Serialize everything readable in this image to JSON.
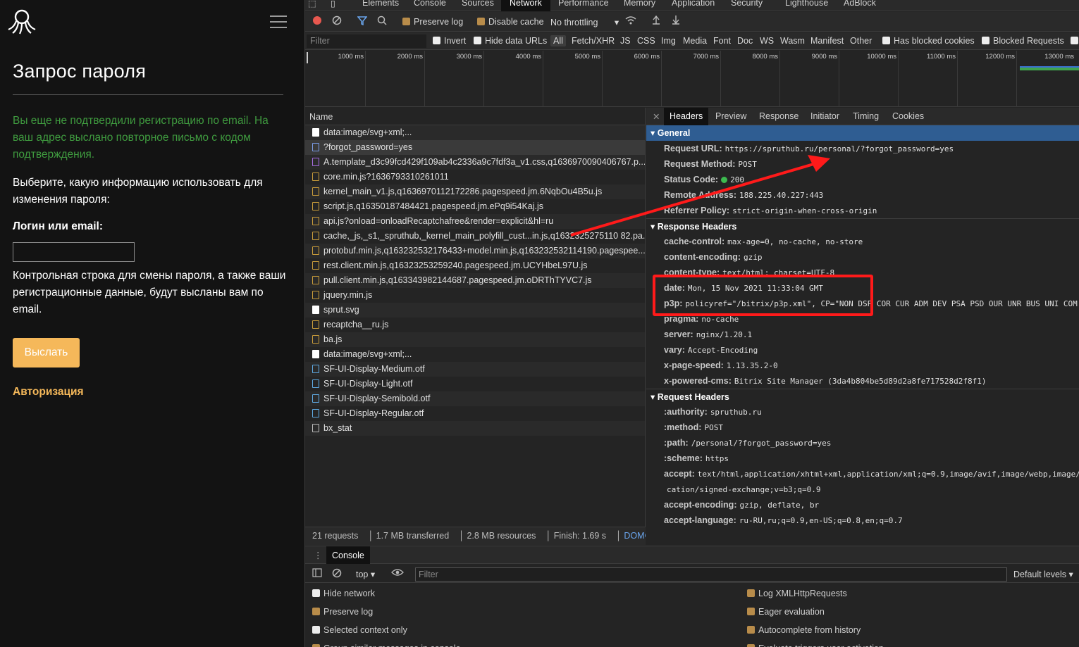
{
  "site": {
    "title": "Запрос пароля",
    "notice": "Вы еще не подтвердили регистрацию по email. На ваш адрес выслано повторное письмо с кодом подтверждения.",
    "choose": "Выберите, какую информацию использовать для изменения пароля:",
    "login_label": "Логин или email:",
    "login_value": "",
    "control_text": "Контрольная строка для смены пароля, а также ваши регистрационные данные, будут высланы вам по email.",
    "send_button": "Выслать",
    "auth_link": "Авторизация",
    "colors": {
      "notice": "#3f9b3f",
      "accent": "#f5b85a",
      "background": "#131313"
    }
  },
  "devtools": {
    "tabs": [
      "Elements",
      "Console",
      "Sources",
      "Network",
      "Performance",
      "Memory",
      "Application",
      "Security",
      "Lighthouse",
      "AdBlock"
    ],
    "active_tab": "Network",
    "toolbar": {
      "preserve_log": "Preserve log",
      "disable_cache": "Disable cache",
      "throttling": "No throttling"
    },
    "filterbar": {
      "filter_placeholder": "Filter",
      "invert": "Invert",
      "hide_data_urls": "Hide data URLs",
      "types": [
        "All",
        "Fetch/XHR",
        "JS",
        "CSS",
        "Img",
        "Media",
        "Font",
        "Doc",
        "WS",
        "Wasm",
        "Manifest",
        "Other"
      ],
      "has_blocked_cookies": "Has blocked cookies",
      "blocked_requests": "Blocked Requests"
    },
    "timeline_ticks": [
      "1000 ms",
      "2000 ms",
      "3000 ms",
      "4000 ms",
      "5000 ms",
      "6000 ms",
      "7000 ms",
      "8000 ms",
      "9000 ms",
      "10000 ms",
      "11000 ms",
      "12000 ms",
      "13000 ms"
    ],
    "name_header": "Name",
    "requests": [
      {
        "name": "data:image/svg+xml;...",
        "type": "img"
      },
      {
        "name": "?forgot_password=yes",
        "type": "doc"
      },
      {
        "name": "A.template_d3c99fcd429f109ab4c2336a9c7fdf3a_v1.css,q1636970090406767.p...",
        "type": "css"
      },
      {
        "name": "core.min.js?1636793310261011",
        "type": "js"
      },
      {
        "name": "kernel_main_v1.js,q1636970112172286.pagespeed.jm.6NqbOu4B5u.js",
        "type": "js"
      },
      {
        "name": "script.js,q16350187484421.pagespeed.jm.ePq9i54Kaj.js",
        "type": "js"
      },
      {
        "name": "api.js?onload=onloadRecaptchafree&render=explicit&hl=ru",
        "type": "js"
      },
      {
        "name": "cache,_js,_s1,_spruthub,_kernel_main_polyfill_cust...in.js,q1632325275110 82.pa...",
        "type": "js"
      },
      {
        "name": "protobuf.min.js,q163232532176433+model.min.js,q163232532114190.pagespee...",
        "type": "js"
      },
      {
        "name": "rest.client.min.js,q16323253259240.pagespeed.jm.UCYHbeL97U.js",
        "type": "js"
      },
      {
        "name": "pull.client.min.js,q163343982144687.pagespeed.jm.oDRThTYVC7.js",
        "type": "js"
      },
      {
        "name": "jquery.min.js",
        "type": "js"
      },
      {
        "name": "sprut.svg",
        "type": "img"
      },
      {
        "name": "recaptcha__ru.js",
        "type": "js"
      },
      {
        "name": "ba.js",
        "type": "js"
      },
      {
        "name": "data:image/svg+xml;...",
        "type": "img"
      },
      {
        "name": "SF-UI-Display-Medium.otf",
        "type": "font"
      },
      {
        "name": "SF-UI-Display-Light.otf",
        "type": "font"
      },
      {
        "name": "SF-UI-Display-Semibold.otf",
        "type": "font"
      },
      {
        "name": "SF-UI-Display-Regular.otf",
        "type": "font"
      },
      {
        "name": "bx_stat",
        "type": "other"
      }
    ],
    "selected_request": 1,
    "status_bar": {
      "requests": "21 requests",
      "transferred": "1.7 MB transferred",
      "resources": "2.8 MB resources",
      "finish": "Finish: 1.69 s",
      "domcontent": "DOMConter"
    },
    "detail_tabs": [
      "Headers",
      "Preview",
      "Response",
      "Initiator",
      "Timing",
      "Cookies"
    ],
    "active_detail_tab": "Headers",
    "general": {
      "title": "General",
      "rows": [
        {
          "k": "Request URL:",
          "v": "https://spruthub.ru/personal/?forgot_password=yes"
        },
        {
          "k": "Request Method:",
          "v": "POST"
        },
        {
          "k": "Status Code:",
          "v": "200"
        },
        {
          "k": "Remote Address:",
          "v": "188.225.40.227:443"
        },
        {
          "k": "Referrer Policy:",
          "v": "strict-origin-when-cross-origin"
        }
      ]
    },
    "response_headers": {
      "title": "Response Headers",
      "rows": [
        {
          "k": "cache-control:",
          "v": "max-age=0, no-cache, no-store"
        },
        {
          "k": "content-encoding:",
          "v": "gzip"
        },
        {
          "k": "content-type:",
          "v": "text/html; charset=UTF-8"
        },
        {
          "k": "date:",
          "v": "Mon, 15 Nov 2021 11:33:04 GMT"
        },
        {
          "k": "p3p:",
          "v": "policyref=\"/bitrix/p3p.xml\", CP=\"NON DSP COR CUR ADM DEV PSA PSD OUR UNR BUS UNI COM"
        },
        {
          "k": "pragma:",
          "v": "no-cache"
        },
        {
          "k": "server:",
          "v": "nginx/1.20.1"
        },
        {
          "k": "vary:",
          "v": "Accept-Encoding"
        },
        {
          "k": "x-page-speed:",
          "v": "1.13.35.2-0"
        },
        {
          "k": "x-powered-cms:",
          "v": "Bitrix Site Manager (3da4b804be5d89d2a8fe717528d2f8f1)"
        }
      ]
    },
    "request_headers": {
      "title": "Request Headers",
      "rows": [
        {
          "k": ":authority:",
          "v": "spruthub.ru"
        },
        {
          "k": ":method:",
          "v": "POST"
        },
        {
          "k": ":path:",
          "v": "/personal/?forgot_password=yes"
        },
        {
          "k": ":scheme:",
          "v": "https"
        },
        {
          "k": "accept:",
          "v": "text/html,application/xhtml+xml,application/xml;q=0.9,image/avif,image/webp,image/"
        },
        {
          "k": "",
          "v": "cation/signed-exchange;v=b3;q=0.9"
        },
        {
          "k": "accept-encoding:",
          "v": "gzip, deflate, br"
        },
        {
          "k": "accept-language:",
          "v": "ru-RU,ru;q=0.9,en-US;q=0.8,en;q=0.7"
        }
      ]
    },
    "console": {
      "tab": "Console",
      "context": "top",
      "filter_placeholder": "Filter",
      "levels": "Default levels",
      "settings_left": [
        {
          "label": "Hide network",
          "checked": false
        },
        {
          "label": "Preserve log",
          "checked": true
        },
        {
          "label": "Selected context only",
          "checked": false
        },
        {
          "label": "Group similar messages in console",
          "checked": true
        }
      ],
      "settings_right": [
        {
          "label": "Log XMLHttpRequests",
          "checked": true
        },
        {
          "label": "Eager evaluation",
          "checked": true
        },
        {
          "label": "Autocomplete from history",
          "checked": true
        },
        {
          "label": "Evaluate triggers user activation",
          "checked": true
        }
      ]
    }
  }
}
